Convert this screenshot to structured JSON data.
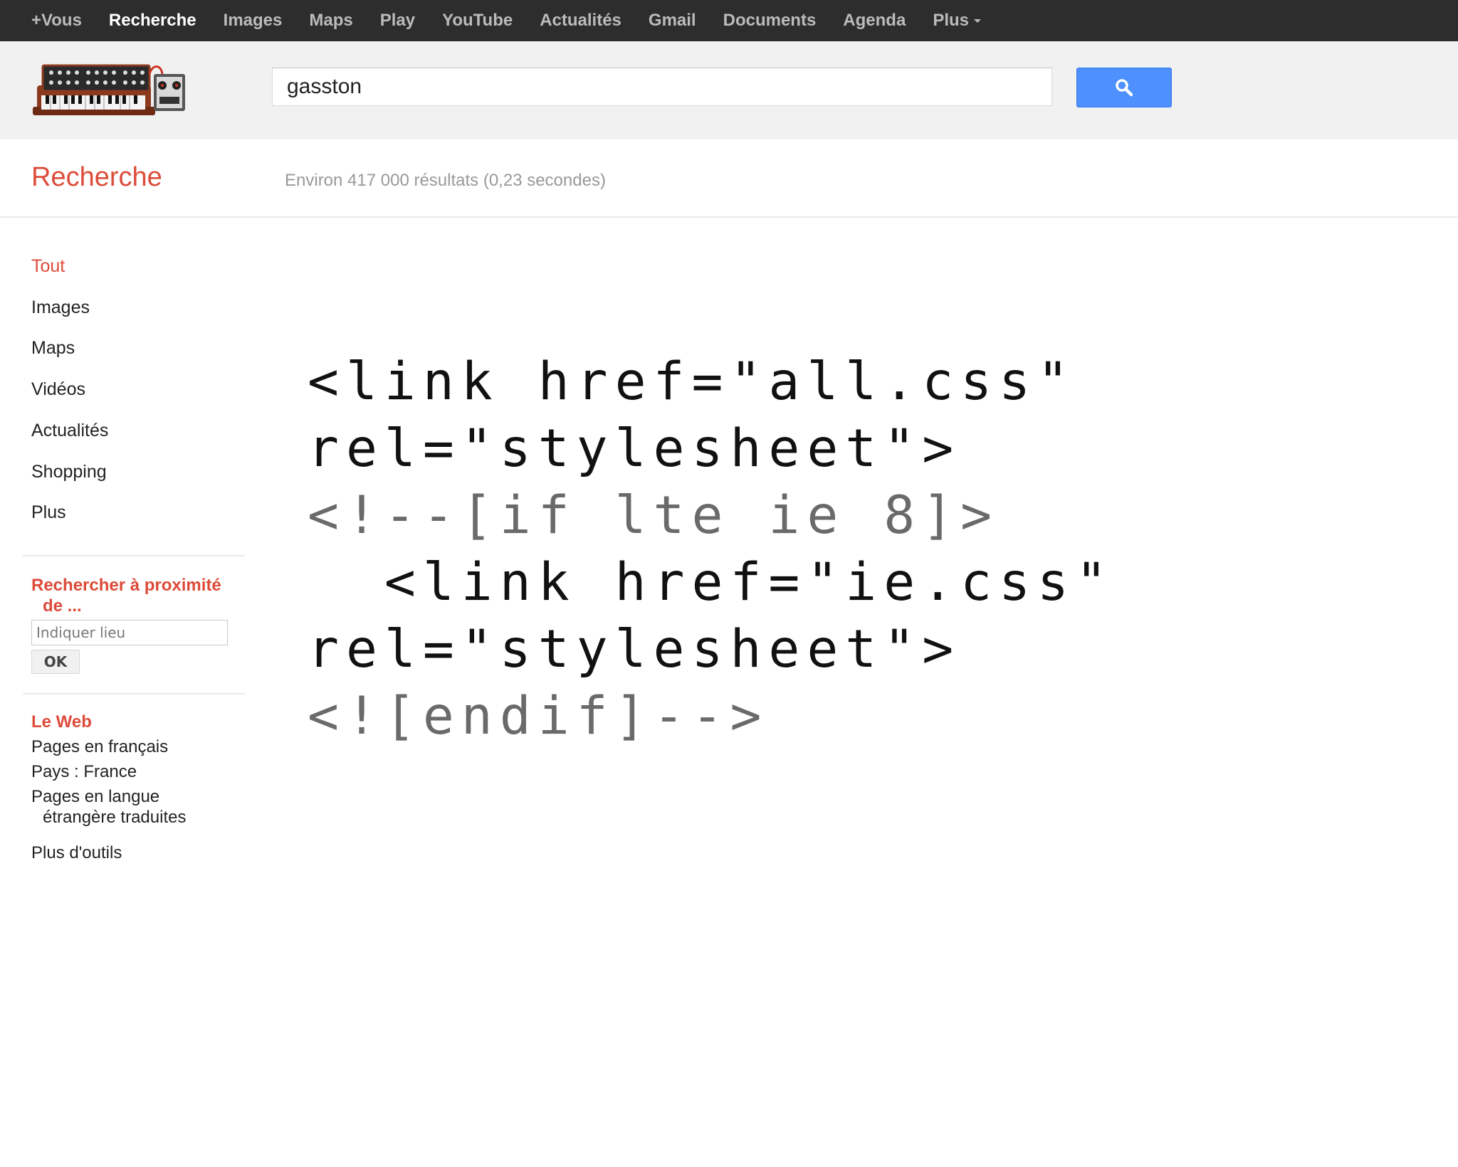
{
  "topnav": {
    "items": [
      "+Vous",
      "Recherche",
      "Images",
      "Maps",
      "Play",
      "YouTube",
      "Actualités",
      "Gmail",
      "Documents",
      "Agenda",
      "Plus"
    ],
    "active_index": 1
  },
  "search": {
    "query": "gasston"
  },
  "subheader": {
    "title": "Recherche",
    "stats": "Environ 417 000 résultats (0,23 secondes)"
  },
  "sidebar": {
    "nav": [
      "Tout",
      "Images",
      "Maps",
      "Vidéos",
      "Actualités",
      "Shopping",
      "Plus"
    ],
    "nearby_heading_line1": "Rechercher à proximité",
    "nearby_heading_line2": "de ...",
    "location_placeholder": "Indiquer lieu",
    "ok_label": "OK",
    "web_heading": "Le Web",
    "tools": {
      "french": "Pages en français",
      "country": "Pays : France",
      "translated_line1": "Pages en langue",
      "translated_line2": "étrangère traduites",
      "more": "Plus d'outils"
    }
  },
  "code_lines": [
    {
      "text": "<link href=\"all.css\"",
      "style": "dark"
    },
    {
      "text": "rel=\"stylesheet\">",
      "style": "dark"
    },
    {
      "text": "<!--[if lte ie 8]>",
      "style": "gray"
    },
    {
      "text": "  <link href=\"ie.css\"",
      "style": "dark"
    },
    {
      "text": "rel=\"stylesheet\">",
      "style": "dark"
    },
    {
      "text": "<![endif]-->",
      "style": "gray"
    }
  ],
  "colors": {
    "accent_red": "#dd4b39",
    "search_blue": "#4d90fe",
    "topbar_bg": "#2d2d2d"
  },
  "icons": {
    "search_button": "magnifier-icon",
    "logo": "synthesizer-doodle-logo"
  }
}
